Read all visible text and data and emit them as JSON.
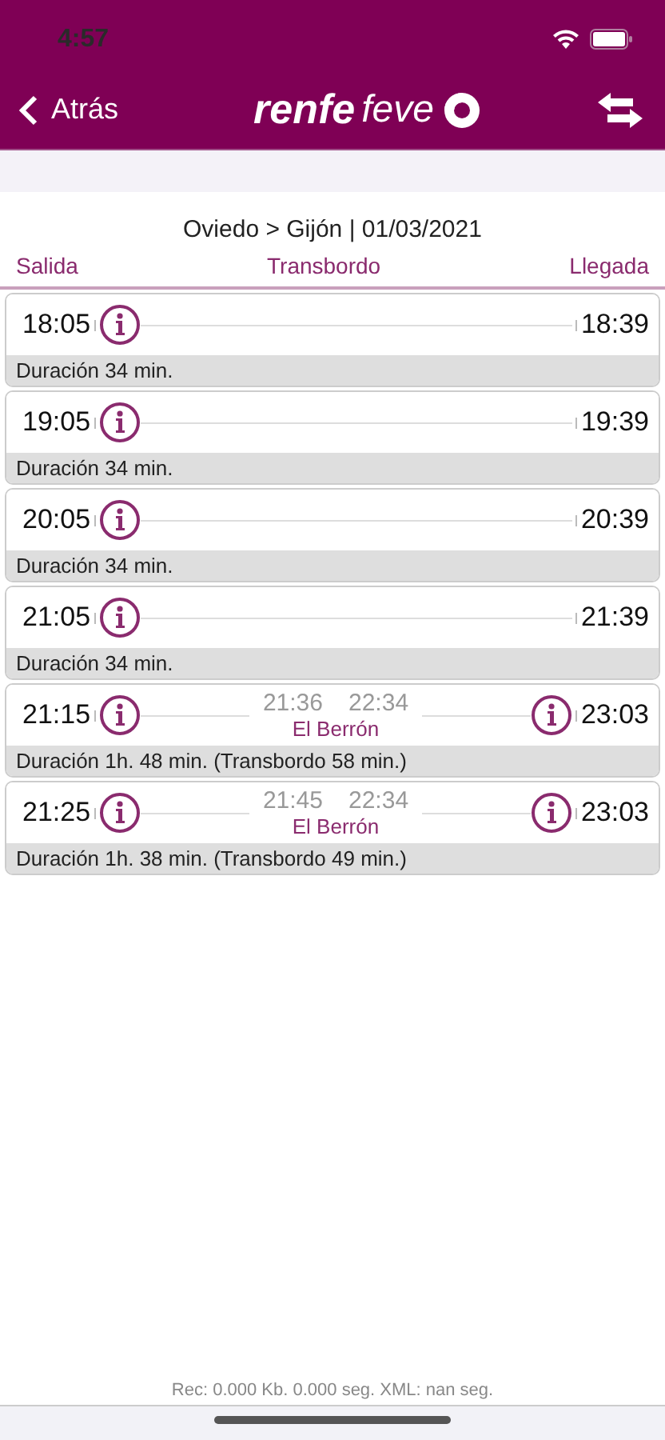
{
  "status_bar": {
    "time": "4:57"
  },
  "nav": {
    "back": "Atrás",
    "logo_bold": "renfe",
    "logo_light": "feve"
  },
  "route": "Oviedo > Gijón | 01/03/2021",
  "columns": [
    "Salida",
    "Transbordo",
    "Llegada"
  ],
  "trips": [
    {
      "kind": "direct",
      "departure": "18:05",
      "arrival": "18:39",
      "duration": "Duración 34 min."
    },
    {
      "kind": "direct",
      "departure": "19:05",
      "arrival": "19:39",
      "duration": "Duración 34 min."
    },
    {
      "kind": "direct",
      "departure": "20:05",
      "arrival": "20:39",
      "duration": "Duración 34 min."
    },
    {
      "kind": "direct",
      "departure": "21:05",
      "arrival": "21:39",
      "duration": "Duración 34 min."
    },
    {
      "kind": "transfer",
      "departure": "21:15",
      "arrival": "23:03",
      "transfer_arrival": "21:36",
      "transfer_departure": "22:34",
      "station": "El Berrón",
      "duration": "Duración 1h. 48 min. (Transbordo 58 min.)"
    },
    {
      "kind": "transfer",
      "departure": "21:25",
      "arrival": "23:03",
      "transfer_arrival": "21:45",
      "transfer_departure": "22:34",
      "station": "El Berrón",
      "duration": "Duración 1h. 38 min. (Transbordo 49 min.)"
    }
  ],
  "footer": "Rec: 0.000 Kb. 0.000 seg. XML: nan seg."
}
